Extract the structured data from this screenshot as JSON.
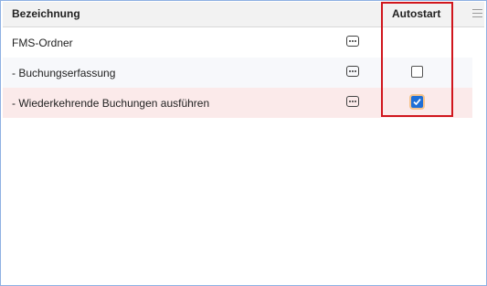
{
  "header": {
    "name_column": "Bezeichnung",
    "autostart_column": "Autostart"
  },
  "rows": [
    {
      "label": "FMS-Ordner",
      "has_checkbox": false,
      "checked": false
    },
    {
      "label": "- Buchungserfassung",
      "has_checkbox": true,
      "checked": false
    },
    {
      "label": "- Wiederkehrende Buchungen ausführen",
      "has_checkbox": true,
      "checked": true
    }
  ],
  "icons": {
    "row_action": "more-options-icon",
    "column_menu": "column-menu-icon"
  },
  "colors": {
    "highlight": "#d0161d",
    "checked": "#1f6fd6",
    "selected_row": "#fbeaea"
  }
}
